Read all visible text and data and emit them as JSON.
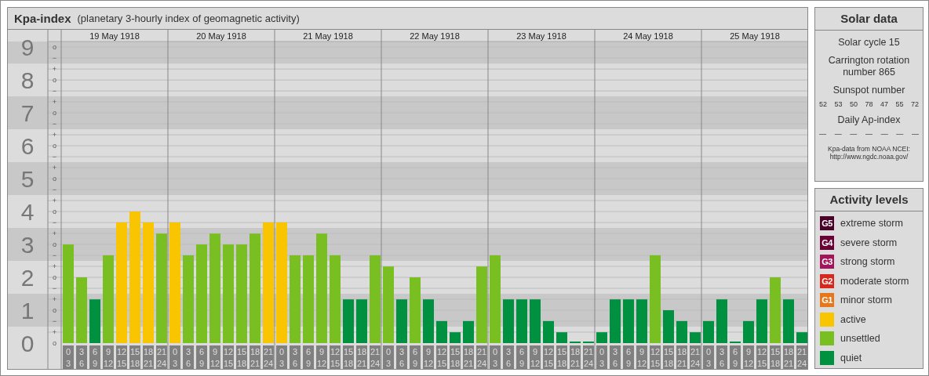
{
  "title": "Kpa-index",
  "subtitle": "(planetary 3-hourly index of geomagnetic activity)",
  "chart": {
    "days": [
      {
        "date": "19 May 1918",
        "slots": [
          {
            "start": "0",
            "end": "3"
          },
          {
            "start": "3",
            "end": "6"
          },
          {
            "start": "6",
            "end": "9"
          },
          {
            "start": "9",
            "end": "12"
          },
          {
            "start": "12",
            "end": "15"
          },
          {
            "start": "15",
            "end": "18"
          },
          {
            "start": "18",
            "end": "21"
          },
          {
            "start": "21",
            "end": "24"
          }
        ]
      },
      {
        "date": "20 May 1918",
        "slots": [
          {
            "start": "0",
            "end": "3"
          },
          {
            "start": "3",
            "end": "6"
          },
          {
            "start": "6",
            "end": "9"
          },
          {
            "start": "9",
            "end": "12"
          },
          {
            "start": "12",
            "end": "15"
          },
          {
            "start": "15",
            "end": "18"
          },
          {
            "start": "18",
            "end": "21"
          },
          {
            "start": "21",
            "end": "24"
          }
        ]
      },
      {
        "date": "21 May 1918",
        "slots": [
          {
            "start": "0",
            "end": "3"
          },
          {
            "start": "3",
            "end": "6"
          },
          {
            "start": "6",
            "end": "9"
          },
          {
            "start": "9",
            "end": "12"
          },
          {
            "start": "12",
            "end": "15"
          },
          {
            "start": "15",
            "end": "18"
          },
          {
            "start": "18",
            "end": "21"
          },
          {
            "start": "21",
            "end": "24"
          }
        ]
      },
      {
        "date": "22 May 1918",
        "slots": [
          {
            "start": "0",
            "end": "3"
          },
          {
            "start": "3",
            "end": "6"
          },
          {
            "start": "6",
            "end": "9"
          },
          {
            "start": "9",
            "end": "12"
          },
          {
            "start": "12",
            "end": "15"
          },
          {
            "start": "15",
            "end": "18"
          },
          {
            "start": "18",
            "end": "21"
          },
          {
            "start": "21",
            "end": "24"
          }
        ]
      },
      {
        "date": "23 May 1918",
        "slots": [
          {
            "start": "0",
            "end": "3"
          },
          {
            "start": "3",
            "end": "6"
          },
          {
            "start": "6",
            "end": "9"
          },
          {
            "start": "9",
            "end": "12"
          },
          {
            "start": "12",
            "end": "15"
          },
          {
            "start": "15",
            "end": "18"
          },
          {
            "start": "18",
            "end": "21"
          },
          {
            "start": "21",
            "end": "24"
          }
        ]
      },
      {
        "date": "24 May 1918",
        "slots": [
          {
            "start": "0",
            "end": "3"
          },
          {
            "start": "3",
            "end": "6"
          },
          {
            "start": "6",
            "end": "9"
          },
          {
            "start": "9",
            "end": "12"
          },
          {
            "start": "12",
            "end": "15"
          },
          {
            "start": "15",
            "end": "18"
          },
          {
            "start": "18",
            "end": "21"
          },
          {
            "start": "21",
            "end": "24"
          }
        ]
      },
      {
        "date": "25 May 1918",
        "slots": [
          {
            "start": "0",
            "end": "3"
          },
          {
            "start": "3",
            "end": "6"
          },
          {
            "start": "6",
            "end": "9"
          },
          {
            "start": "9",
            "end": "12"
          },
          {
            "start": "12",
            "end": "15"
          },
          {
            "start": "15",
            "end": "18"
          },
          {
            "start": "18",
            "end": "21"
          },
          {
            "start": "21",
            "end": "24"
          }
        ]
      }
    ],
    "subdivision_marks": [
      "o",
      "−",
      "+",
      "o",
      "−",
      "+",
      "o",
      "−",
      "+",
      "o",
      "−",
      "+",
      "o",
      "−",
      "+",
      "o",
      "−",
      "+",
      "o",
      "−",
      "+",
      "o",
      "−",
      "+",
      "o",
      "−",
      "+",
      "o"
    ],
    "chart_data": {
      "type": "bar",
      "ylim": [
        0,
        9.17
      ],
      "yticks": [
        0,
        1,
        2,
        3,
        4,
        5,
        6,
        7,
        8,
        9
      ],
      "grid": true,
      "values": [
        3,
        2,
        1.33,
        2.67,
        3.67,
        4,
        3.67,
        3.33,
        3.67,
        2.67,
        3,
        3.33,
        3,
        3,
        3.33,
        3.67,
        3.67,
        2.67,
        2.67,
        3.33,
        2.67,
        1.33,
        1.33,
        2.67,
        2.33,
        1.33,
        2,
        1.33,
        0.67,
        0.33,
        0.67,
        2.33,
        2.67,
        1.33,
        1.33,
        1.33,
        0.67,
        0.33,
        0,
        0,
        0.33,
        1.33,
        1.33,
        1.33,
        2.67,
        1,
        0.67,
        0.33,
        0.67,
        1.33,
        0,
        0.67,
        1.33,
        2,
        1.33,
        0.33
      ]
    }
  },
  "solar": {
    "title": "Solar data",
    "cycle": "Solar cycle 15",
    "carrington": "Carrington rotation number 865",
    "sunspot_label": "Sunspot number",
    "sunspot_values": [
      "52",
      "53",
      "50",
      "78",
      "47",
      "55",
      "72"
    ],
    "ap_label": "Daily Ap-index",
    "ap_values": [
      "—",
      "—",
      "—",
      "—",
      "—",
      "—",
      "—"
    ],
    "credit": "Kpa-data from NOAA NCEI:",
    "credit_url": "http://www.ngdc.noaa.gov/"
  },
  "legend": {
    "title": "Activity levels",
    "items": [
      {
        "kind": "storm",
        "badge": "G5",
        "label": "extreme storm",
        "color": "#4a0028"
      },
      {
        "kind": "storm",
        "badge": "G4",
        "label": "severe storm",
        "color": "#6b0036"
      },
      {
        "kind": "storm",
        "badge": "G3",
        "label": "strong storm",
        "color": "#a3145a"
      },
      {
        "kind": "storm",
        "badge": "G2",
        "label": "moderate storm",
        "color": "#d8281e"
      },
      {
        "kind": "storm",
        "badge": "G1",
        "label": "minor storm",
        "color": "#e8761a"
      },
      {
        "kind": "level",
        "label": "active",
        "color": "#f9c400"
      },
      {
        "kind": "level",
        "label": "unsettled",
        "color": "#79bf21"
      },
      {
        "kind": "level",
        "label": "quiet",
        "color": "#009140"
      }
    ]
  }
}
